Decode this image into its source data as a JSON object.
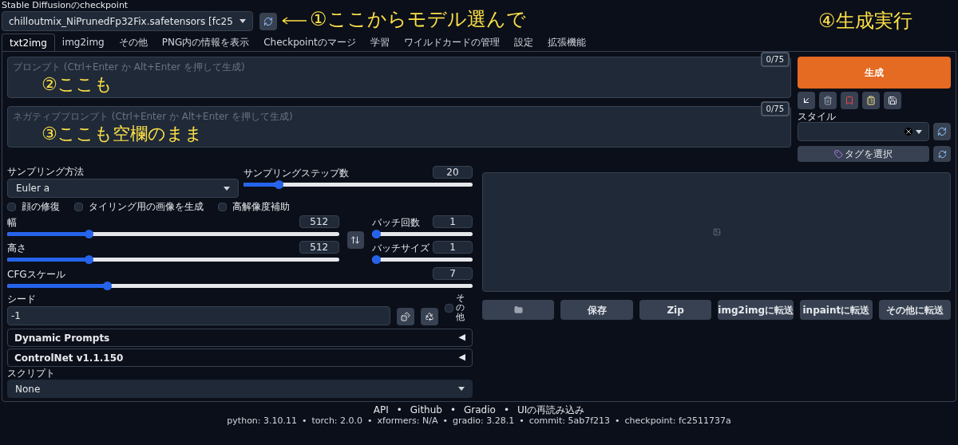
{
  "checkpoint": {
    "label": "Stable Diffusionのcheckpoint",
    "value": "chilloutmix_NiPrunedFp32Fix.safetensors [fc25"
  },
  "tabs": [
    {
      "label": "txt2img",
      "selected": true
    },
    {
      "label": "img2img",
      "selected": false
    },
    {
      "label": "その他",
      "selected": false
    },
    {
      "label": "PNG内の情報を表示",
      "selected": false
    },
    {
      "label": "Checkpointのマージ",
      "selected": false
    },
    {
      "label": "学習",
      "selected": false
    },
    {
      "label": "ワイルドカードの管理",
      "selected": false
    },
    {
      "label": "設定",
      "selected": false
    },
    {
      "label": "拡張機能",
      "selected": false
    }
  ],
  "prompt": {
    "placeholder": "プロンプト (Ctrl+Enter か Alt+Enter を押して生成)",
    "counter": "0/75"
  },
  "negative_prompt": {
    "placeholder": "ネガティブプロンプト (Ctrl+Enter か Alt+Enter を押して生成)",
    "counter": "0/75"
  },
  "generate_button": "生成",
  "style": {
    "label": "スタイル"
  },
  "tag_button": "タグを選択",
  "sampling_method": {
    "label": "サンプリング方法",
    "value": "Euler a"
  },
  "sliders": [
    {
      "label": "サンプリングステップ数",
      "value": "20",
      "level": 0.14
    },
    {
      "label": "幅",
      "value": "512",
      "level": 0.24
    },
    {
      "label": "バッチ回数",
      "value": "1",
      "level": 0
    },
    {
      "label": "高さ",
      "value": "512",
      "level": 0.24
    },
    {
      "label": "バッチサイズ",
      "value": "1",
      "level": 0
    },
    {
      "label": "CFGスケール",
      "value": "7",
      "level": 0.21
    }
  ],
  "checkboxes": [
    {
      "label": "顔の修復",
      "checked": false
    },
    {
      "label": "タイリング用の画像を生成",
      "checked": false
    },
    {
      "label": "高解像度補助",
      "checked": false
    }
  ],
  "seed": {
    "label": "シード",
    "value": "-1"
  },
  "extra_checkbox": {
    "label": "その他",
    "checked": false
  },
  "accordions": [
    {
      "title": "Dynamic Prompts",
      "marker": "◀"
    },
    {
      "title": "ControlNet v1.1.150",
      "marker": "◀"
    }
  ],
  "script": {
    "label": "スクリプト",
    "value": "None"
  },
  "output_buttons": [
    {
      "kind": "folder"
    },
    {
      "kind": "text",
      "label": "保存"
    },
    {
      "kind": "text",
      "label": "Zip"
    },
    {
      "kind": "text",
      "label": "img2imgに転送"
    },
    {
      "kind": "text",
      "label": "inpaintに転送"
    },
    {
      "kind": "text",
      "label": "その他に転送"
    }
  ],
  "footer": {
    "separator": "•",
    "links": [
      "API",
      "Github",
      "Gradio",
      "UIの再読み込み"
    ],
    "versions": [
      "python: 3.10.11",
      "torch: 2.0.0",
      "xformers: N/A",
      "gradio: 3.28.1",
      "commit: 5ab7f213",
      "checkpoint: fc2511737a"
    ]
  },
  "annotations": [
    {
      "text": "①ここからモデル選んで"
    },
    {
      "text": "②ここも"
    },
    {
      "text": "③ここも空欄のまま"
    },
    {
      "text": "④生成実行"
    }
  ]
}
